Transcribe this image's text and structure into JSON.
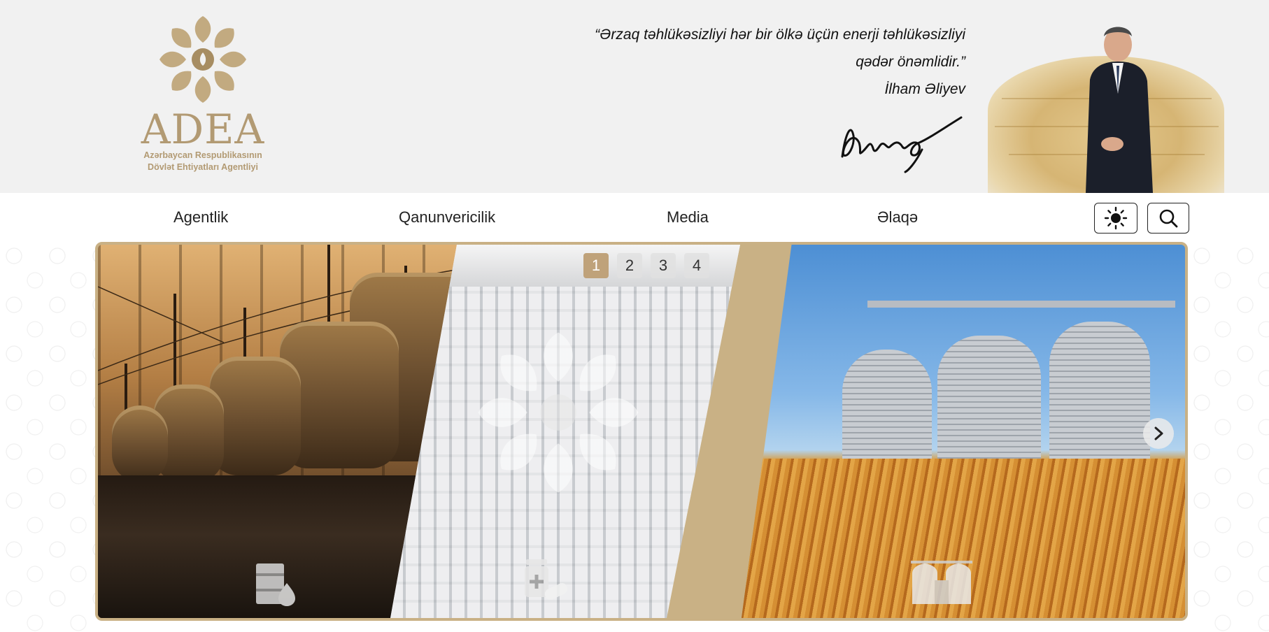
{
  "header": {
    "logo": {
      "word": "ADEA",
      "subtitle_line1": "Azərbaycan Respublikasının",
      "subtitle_line2": "Dövlət Ehtiyatları Agentliyi"
    },
    "quote": {
      "line1": "“Ərzaq təhlükəsizliyi hər bir ölkə üçün enerji təhlükəsizliyi",
      "line2": "qədər önəmlidir.”",
      "author": "İlham Əliyev"
    }
  },
  "nav": {
    "items": [
      {
        "label": "Agentlik"
      },
      {
        "label": "Qanunvericilik"
      },
      {
        "label": "Media"
      },
      {
        "label": "Əlaqə"
      }
    ],
    "theme_icon": "sun-icon",
    "search_icon": "search-icon"
  },
  "slider": {
    "pages": [
      "1",
      "2",
      "3",
      "4"
    ],
    "active_page": "1",
    "panels": [
      {
        "icon": "fuel-icon"
      },
      {
        "icon": "medicine-icon"
      },
      {
        "icon": "granary-icon"
      }
    ]
  },
  "colors": {
    "brand_gold": "#b29a73",
    "active_dot": "#bfa27a",
    "frame": "#c9b185",
    "header_bg": "#f1f1f1"
  }
}
